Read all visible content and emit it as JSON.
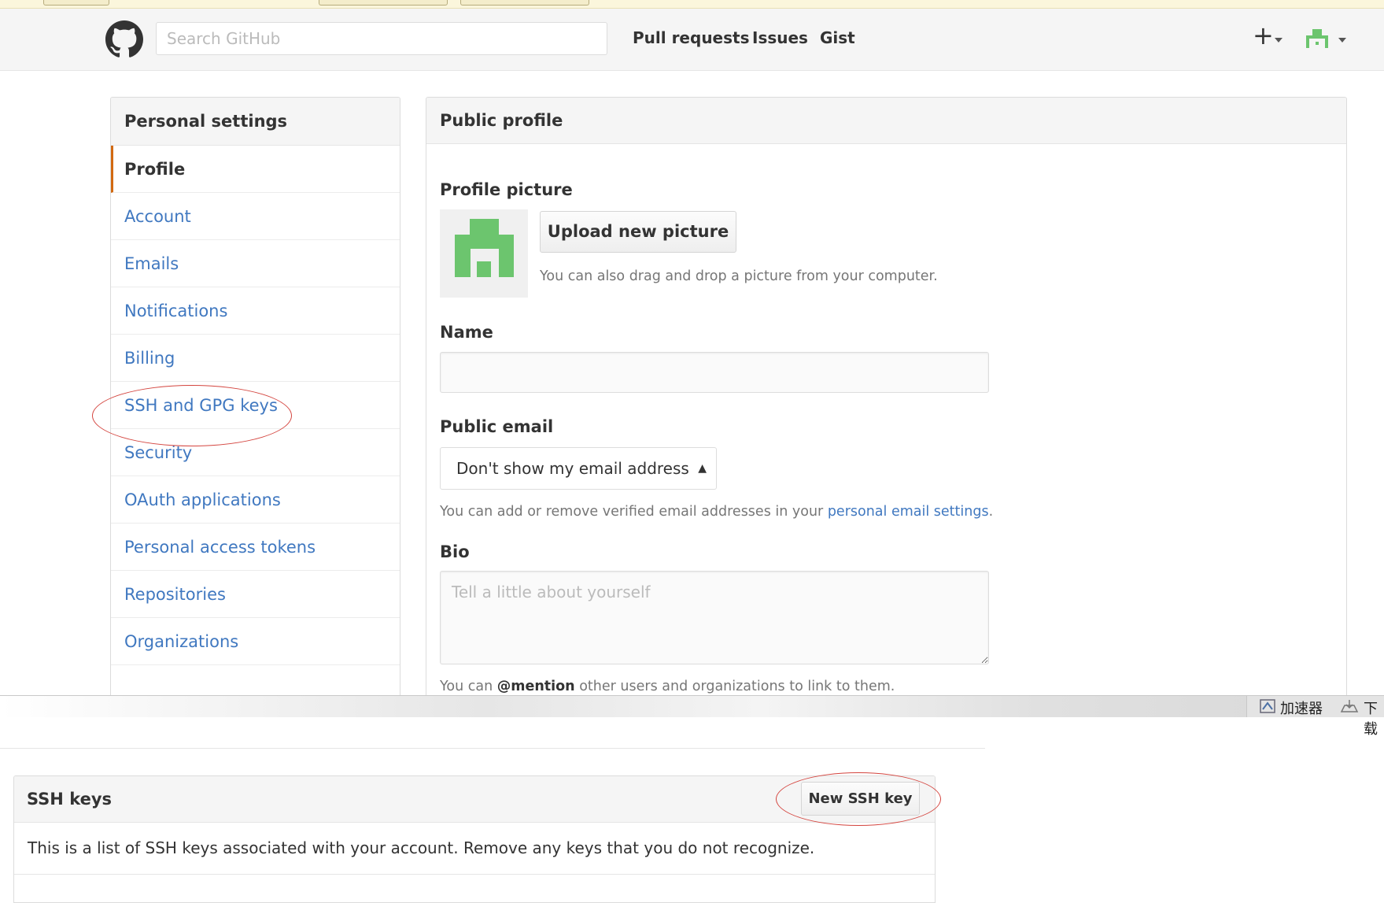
{
  "header": {
    "search_placeholder": "Search GitHub",
    "nav": [
      "Pull requests",
      "Issues",
      "Gist"
    ],
    "new_menu_label": "+"
  },
  "sidebar": {
    "title": "Personal settings",
    "items": [
      {
        "label": "Profile",
        "selected": true
      },
      {
        "label": "Account"
      },
      {
        "label": "Emails"
      },
      {
        "label": "Notifications"
      },
      {
        "label": "Billing"
      },
      {
        "label": "SSH and GPG keys"
      },
      {
        "label": "Security"
      },
      {
        "label": "OAuth applications"
      },
      {
        "label": "Personal access tokens"
      },
      {
        "label": "Repositories"
      },
      {
        "label": "Organizations"
      }
    ]
  },
  "profile": {
    "title": "Public profile",
    "picture_label": "Profile picture",
    "upload_button": "Upload new picture",
    "upload_note": "You can also drag and drop a picture from your computer.",
    "name_label": "Name",
    "name_value": "",
    "email_label": "Public email",
    "email_selected": "Don't show my email address",
    "email_note_prefix": "You can add or remove verified email addresses in your ",
    "email_note_link": "personal email settings",
    "email_note_suffix": ".",
    "bio_label": "Bio",
    "bio_placeholder": "Tell a little about yourself",
    "mention_prefix": "You can ",
    "mention_bold": "@mention",
    "mention_suffix": " other users and organizations to link to them."
  },
  "taskbar": {
    "accelerator": "加速器",
    "download": "下载"
  },
  "ssh_keys": {
    "title": "SSH keys",
    "new_button": "New SSH key",
    "description": "This is a list of SSH keys associated with your account. Remove any keys that you do not recognize."
  },
  "colors": {
    "link": "#4078c0",
    "selected_accent": "#d26911",
    "identicon": "#6cc56e",
    "annotation": "#d4453f"
  }
}
